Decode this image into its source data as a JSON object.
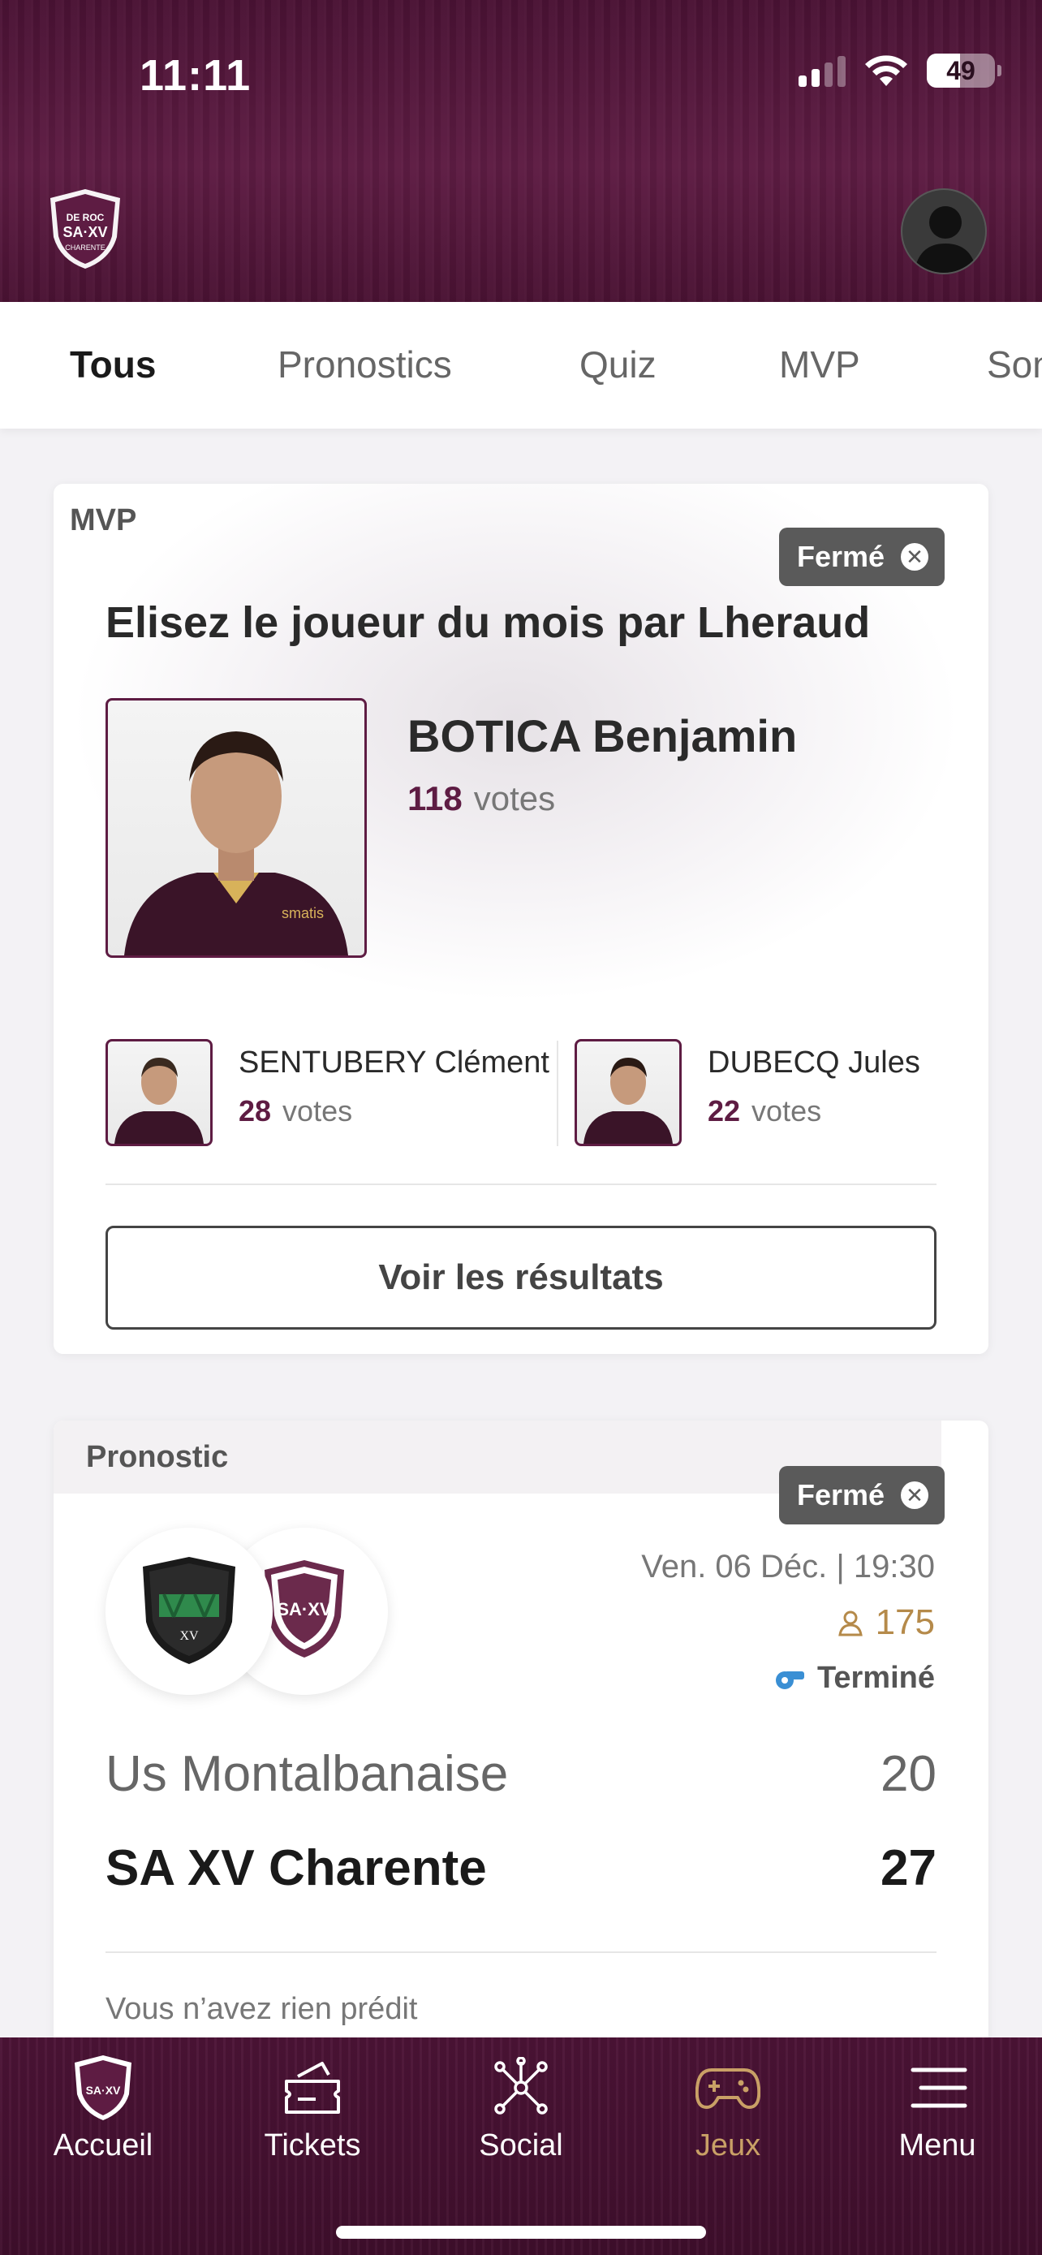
{
  "status_bar": {
    "time": "11:11",
    "battery": "49"
  },
  "tabs": [
    {
      "label": "Tous",
      "active": true
    },
    {
      "label": "Pronostics",
      "active": false
    },
    {
      "label": "Quiz",
      "active": false
    },
    {
      "label": "MVP",
      "active": false
    },
    {
      "label": "Son",
      "active": false
    }
  ],
  "mvp_card": {
    "type": "MVP",
    "badge": "Fermé",
    "title": "Elisez le joueur du mois par Lheraud",
    "winner": {
      "name": "BOTICA Benjamin",
      "votes": "118",
      "votes_label": "votes"
    },
    "runners_up": [
      {
        "name": "SENTUBERY Clément",
        "votes": "28",
        "votes_label": "votes"
      },
      {
        "name": "DUBECQ Jules",
        "votes": "22",
        "votes_label": "votes"
      }
    ],
    "results_button": "Voir les résultats"
  },
  "prono_card": {
    "type": "Pronostic",
    "badge": "Fermé",
    "date": "Ven. 06 Déc. | 19:30",
    "participants": "175",
    "status": "Terminé",
    "home_team": {
      "name": "Us Montalbanaise",
      "score": "20"
    },
    "away_team": {
      "name": "SA XV Charente",
      "score": "27"
    },
    "prediction_note": "Vous n’avez rien prédit"
  },
  "bottom_nav": [
    {
      "label": "Accueil",
      "icon": "club-logo-icon",
      "active": false
    },
    {
      "label": "Tickets",
      "icon": "ticket-icon",
      "active": false
    },
    {
      "label": "Social",
      "icon": "network-icon",
      "active": false
    },
    {
      "label": "Jeux",
      "icon": "gamepad-icon",
      "active": true
    },
    {
      "label": "Menu",
      "icon": "hamburger-icon",
      "active": false
    }
  ],
  "colors": {
    "brand": "#5e1c43",
    "accent": "#c9a066",
    "badge": "#5a5a5a"
  }
}
